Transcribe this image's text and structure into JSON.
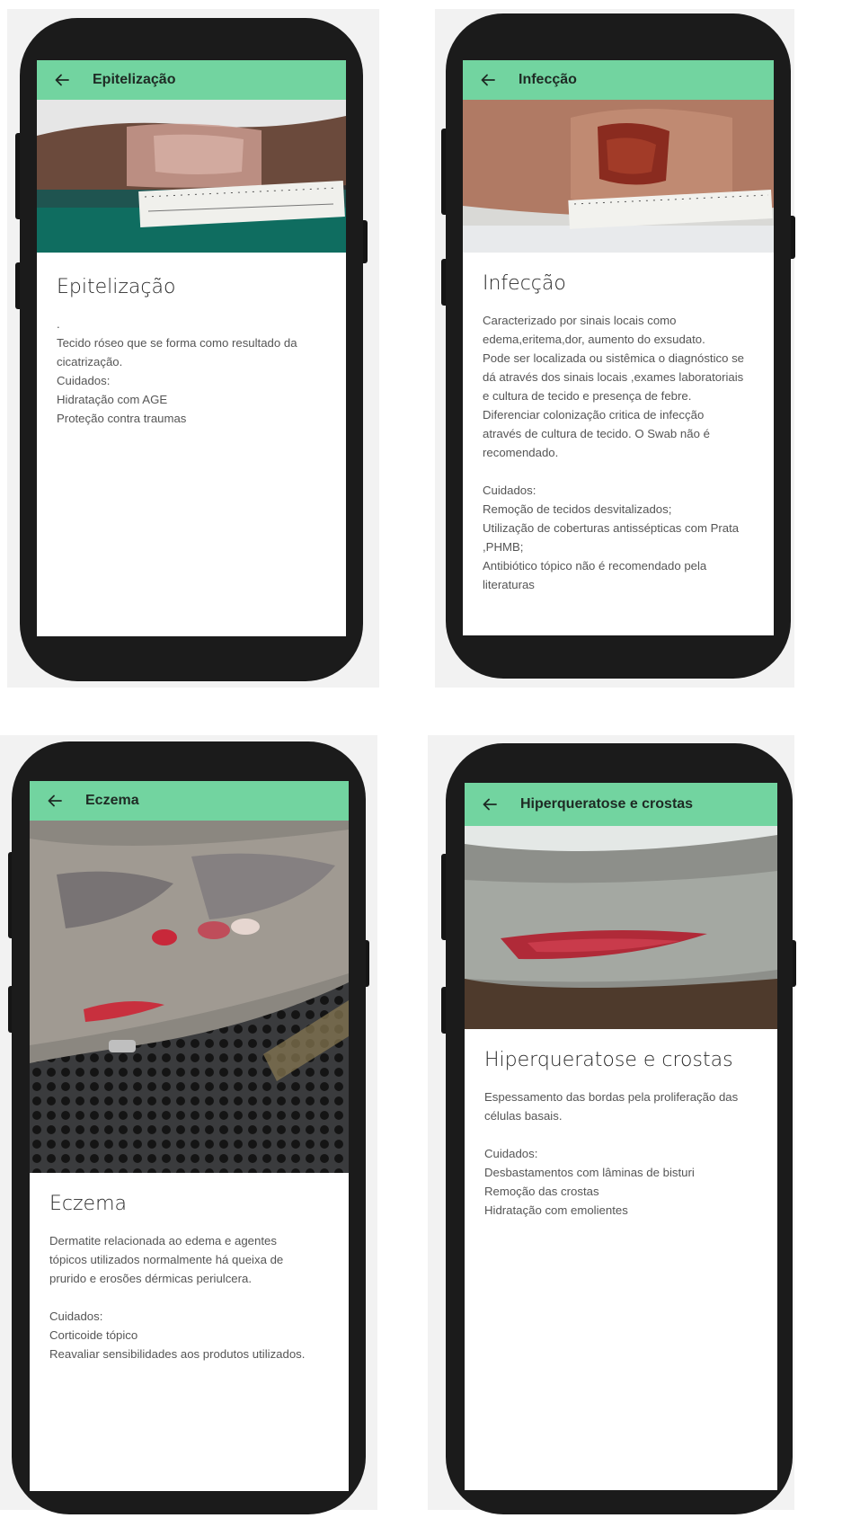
{
  "screens": [
    {
      "title": "Epitelização",
      "heading": "Epitelização",
      "paragraph": [
        ".",
        "Tecido róseo que se forma como resultado da",
        "cicatrização."
      ],
      "care_label": "Cuidados:",
      "care": [
        "Hidratação com AGE",
        "Proteção contra traumas"
      ]
    },
    {
      "title": "Infecção",
      "heading": "Infecção",
      "paragraph": [
        "Caracterizado por sinais locais como",
        "edema,eritema,dor, aumento do exsudato.",
        "Pode ser localizada ou sistêmica o diagnóstico se",
        "dá através dos sinais locais ,exames laboratoriais",
        "e cultura de tecido e presença de febre.",
        "Diferenciar colonização critica de infecção",
        "através de cultura de tecido. O Swab não é",
        "recomendado."
      ],
      "care_label": "Cuidados:",
      "care": [
        "Remoção de tecidos desvitalizados;",
        "Utilização de coberturas antissépticas com Prata",
        ",PHMB;",
        "Antibiótico tópico não é recomendado pela",
        "literaturas"
      ]
    },
    {
      "title": "Eczema",
      "heading": "Eczema",
      "paragraph": [
        "Dermatite relacionada ao edema e agentes",
        "tópicos utilizados normalmente há queixa de",
        "prurido e erosões dérmicas periulcera."
      ],
      "care_label": "Cuidados:",
      "care": [
        "Corticoide tópico",
        "Reavaliar sensibilidades aos produtos utilizados."
      ]
    },
    {
      "title": "Hiperqueratose e crostas",
      "heading": "Hiperqueratose e crostas",
      "paragraph": [
        "Espessamento das bordas pela proliferação das",
        "células basais."
      ],
      "care_label": "Cuidados:",
      "care": [
        "Desbastamentos com lâminas de bisturi",
        "Remoção das crostas",
        "Hidratação com emolientes"
      ]
    }
  ],
  "colors": {
    "appbar": "#72d4a0",
    "phone": "#1b1b1b"
  },
  "icons": {
    "back": "arrow-left-icon"
  }
}
